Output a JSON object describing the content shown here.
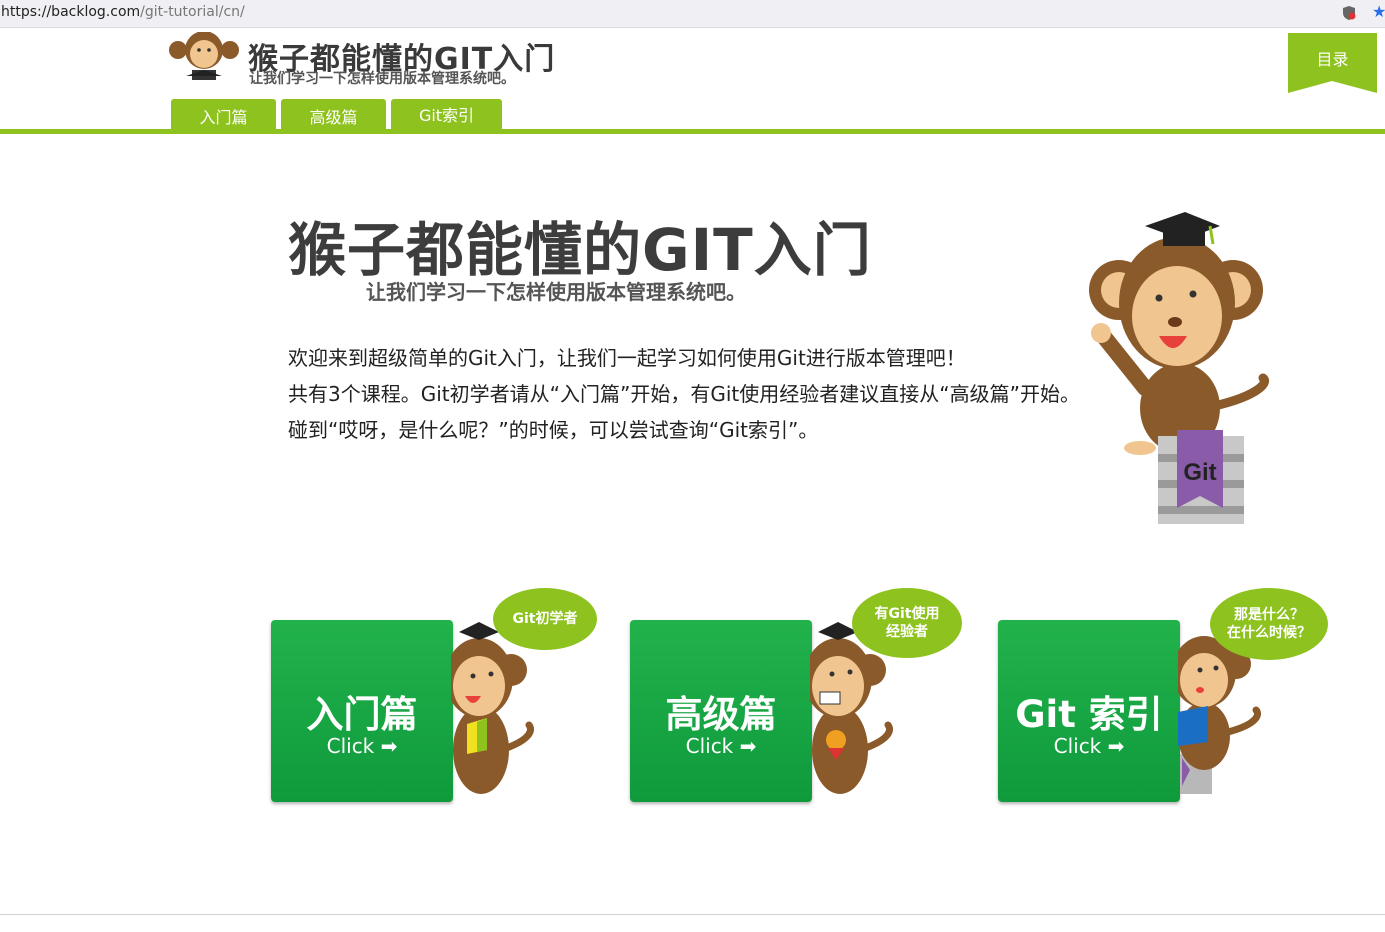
{
  "browser": {
    "url_host": "https://backlog.com",
    "url_path": "/git-tutorial/cn/"
  },
  "header": {
    "logo_title": "猴子都能懂的GIT入门",
    "logo_subtitle": "让我们学习一下怎样使用版本管理系统吧。",
    "nav": [
      "入门篇",
      "高级篇",
      "Git索引"
    ],
    "toc_label": "目录"
  },
  "hero": {
    "title": "猴子都能懂的GIT入门",
    "subtitle": "让我们学习一下怎样使用版本管理系统吧。",
    "intro_line1": "欢迎来到超级简单的Git入门，让我们一起学习如何使用Git进行版本管理吧！",
    "intro_line2": "共有3个课程。Git初学者请从“入门篇”开始，有Git使用经验者建议直接从“高级篇”开始。碰到“哎呀，是什么呢？”的时候，可以尝试查询“Git索引”。",
    "badge_text": "Git"
  },
  "cards": [
    {
      "title": "入门篇",
      "click": "Click",
      "bubble": "Git初学者"
    },
    {
      "title": "高级篇",
      "click": "Click",
      "bubble_line1": "有Git使用",
      "bubble_line2": "经验者"
    },
    {
      "title": "Git 索引",
      "click": "Click",
      "bubble_line1": "那是什么？",
      "bubble_line2": "在什么时候？"
    }
  ],
  "colors": {
    "brand_green": "#8dc21f",
    "card_green": "#1aa845"
  }
}
